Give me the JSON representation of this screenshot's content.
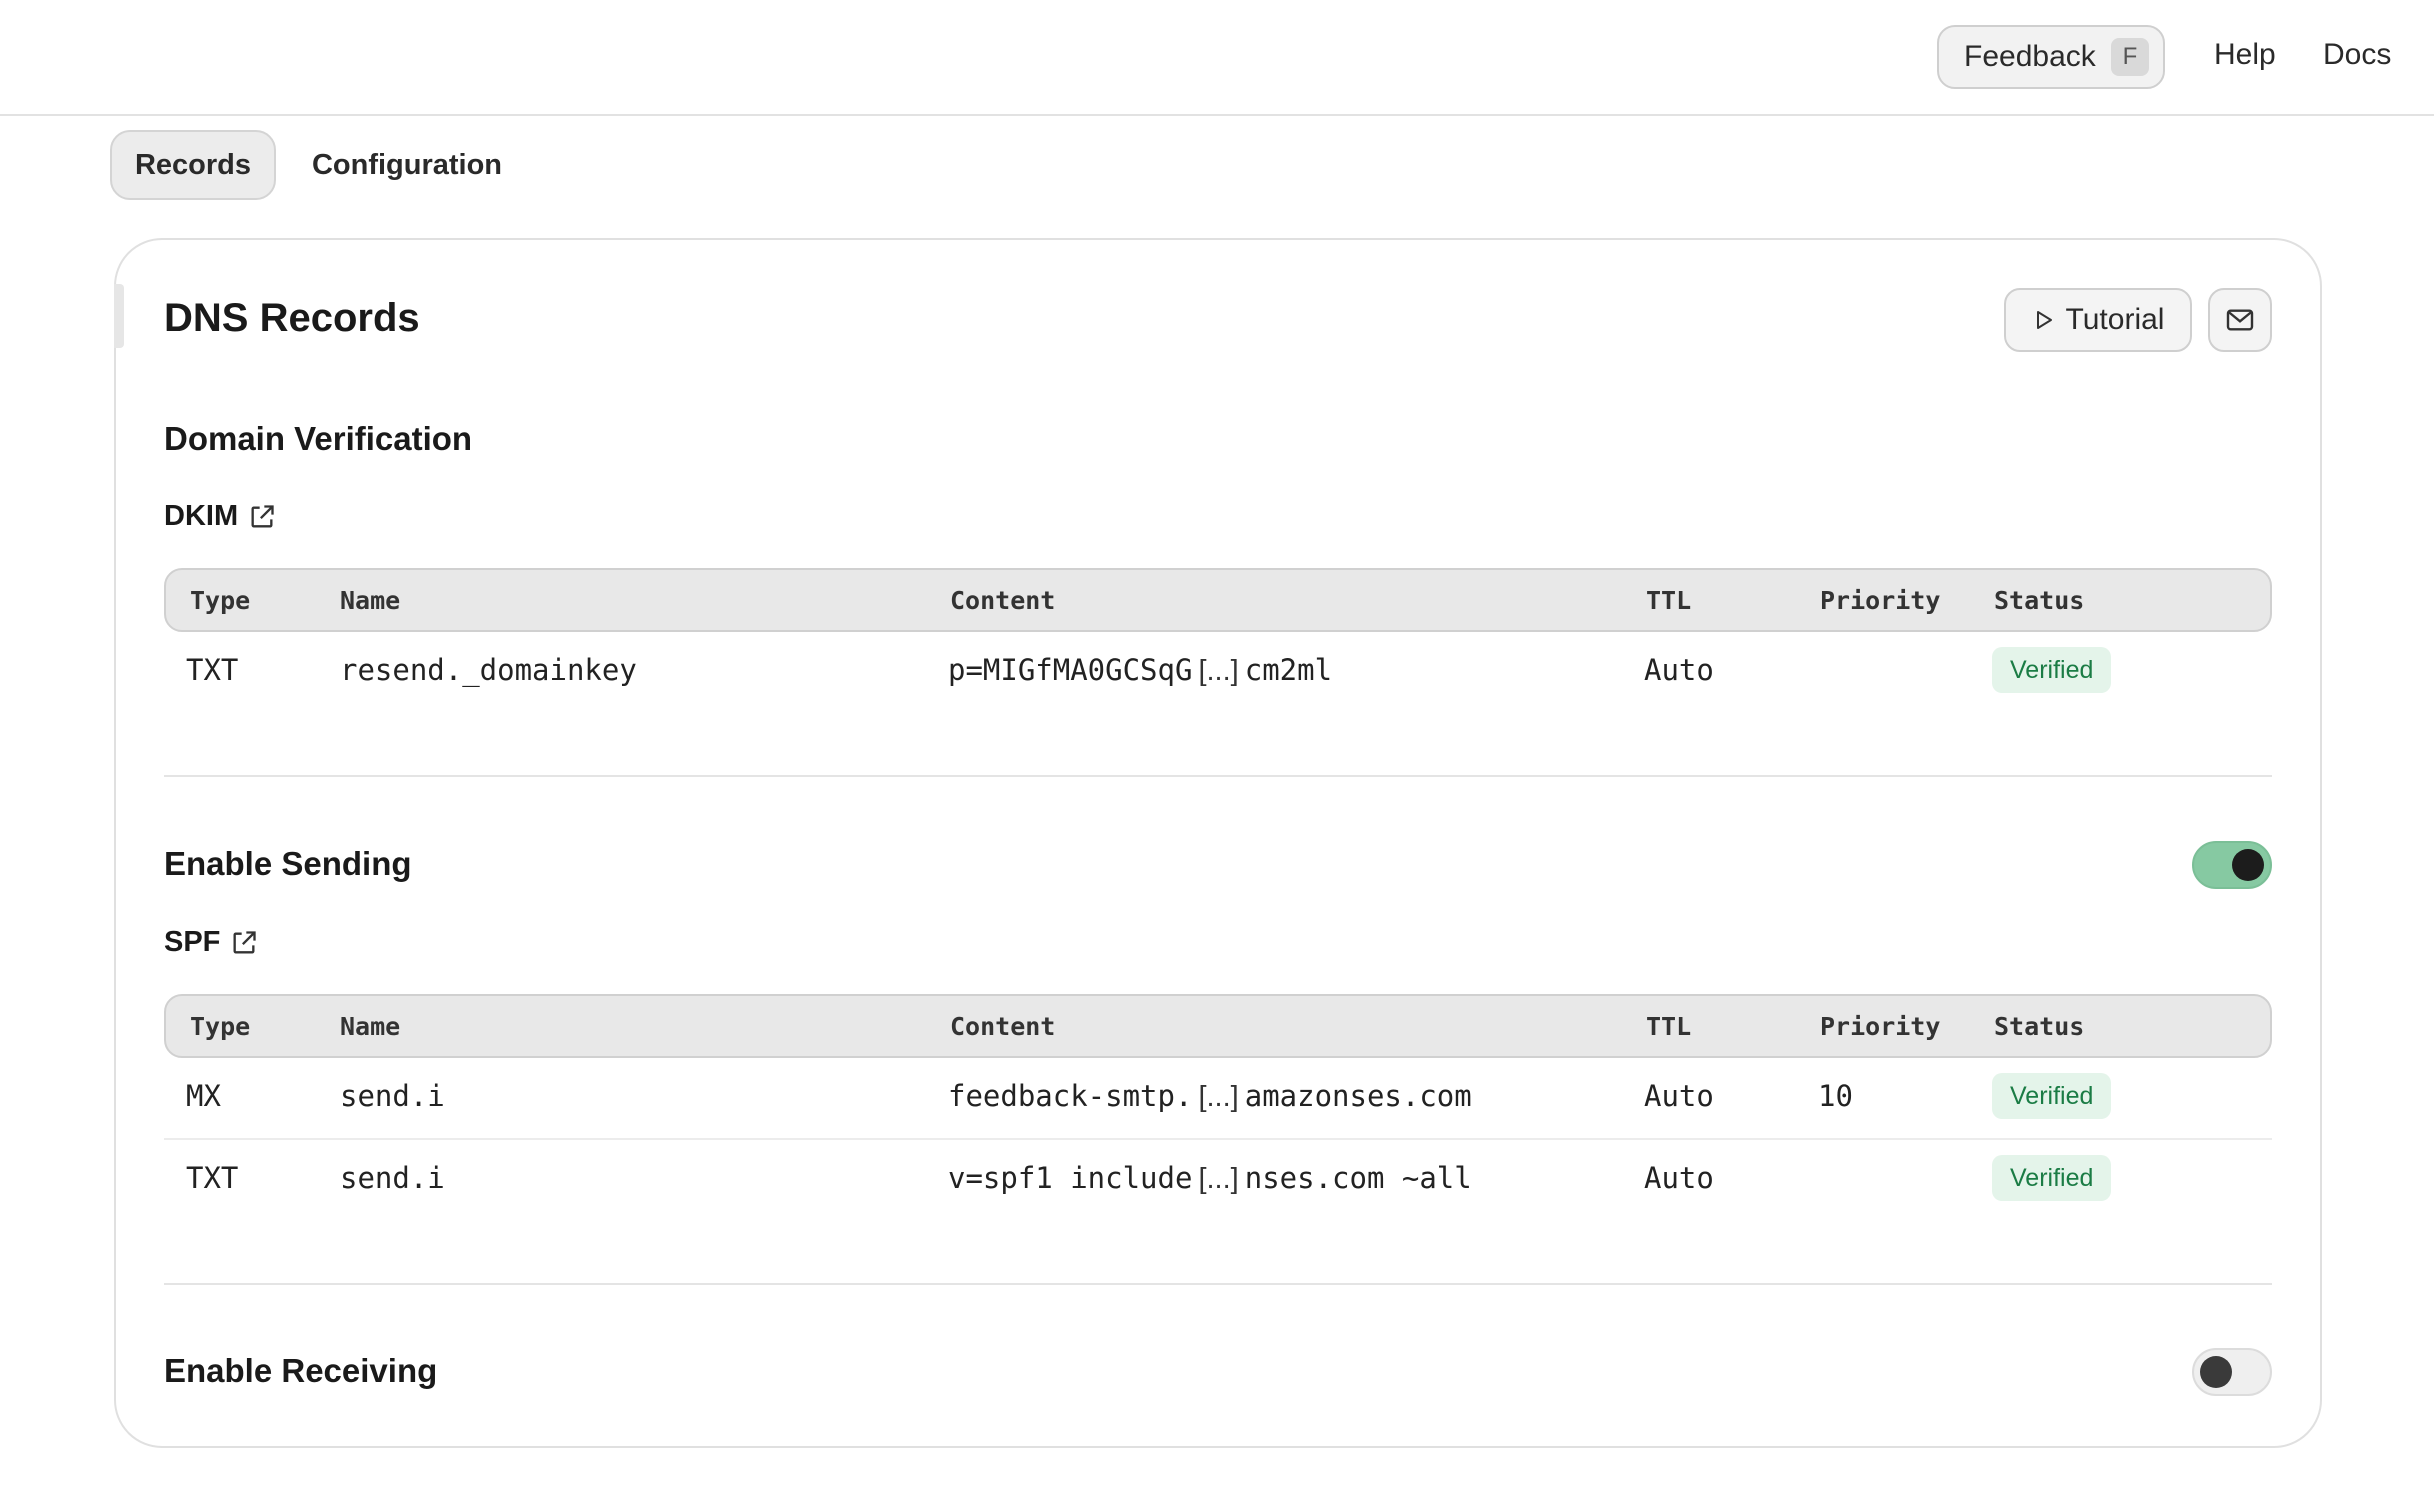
{
  "topbar": {
    "feedback_label": "Feedback",
    "feedback_shortcut": "F",
    "help_label": "Help",
    "docs_label": "Docs"
  },
  "tabs": [
    {
      "label": "Records",
      "active": true
    },
    {
      "label": "Configuration",
      "active": false
    }
  ],
  "card": {
    "title": "DNS Records",
    "tutorial_label": "Tutorial",
    "tutorial_icon": "play-icon",
    "email_icon": "mail-icon"
  },
  "table_headers": {
    "type": "Type",
    "name": "Name",
    "content": "Content",
    "ttl": "TTL",
    "priority": "Priority",
    "status": "Status"
  },
  "domain_verification": {
    "title": "Domain Verification",
    "subtitle": "DKIM",
    "link_icon": "external-link-icon",
    "rows": [
      {
        "type": "TXT",
        "name": "resend._domainkey",
        "content_start": "p=MIGfMA0GCSqG",
        "ellipsis": "[...]",
        "content_end": "cm2ml",
        "ttl": "Auto",
        "priority": "",
        "status": "Verified"
      }
    ]
  },
  "sending": {
    "title": "Enable Sending",
    "enabled": true,
    "subtitle": "SPF",
    "link_icon": "external-link-icon",
    "rows": [
      {
        "type": "MX",
        "name": "send.i",
        "content_start": "feedback-smtp.",
        "ellipsis": "[...]",
        "content_end": "amazonses.com",
        "ttl": "Auto",
        "priority": "10",
        "status": "Verified"
      },
      {
        "type": "TXT",
        "name": "send.i",
        "content_start": "v=spf1 include",
        "ellipsis": "[...]",
        "content_end": "nses.com ~all",
        "ttl": "Auto",
        "priority": "",
        "status": "Verified"
      }
    ]
  },
  "receiving": {
    "title": "Enable Receiving",
    "enabled": false
  },
  "colors": {
    "verified_bg": "#e4f4ea",
    "verified_text": "#1b7c45",
    "toggle_on": "#86c9a2"
  }
}
